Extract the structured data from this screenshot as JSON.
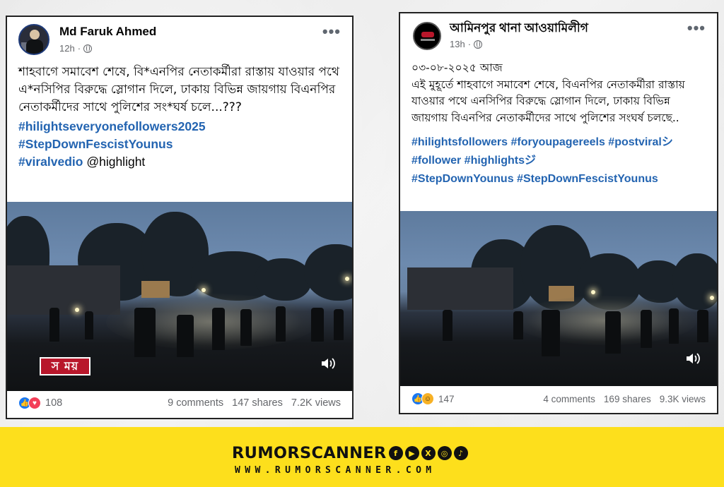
{
  "post1": {
    "author": "Md Faruk Ahmed",
    "time": "12h",
    "more": "•••",
    "text": "শাহবাগে সমাবেশ শেষে, বি*এনপির নেতাকর্মীরা রাস্তায় যাওয়ার পথে এ*নসিপির বিরুদ্ধে স্লোগান দিলে, ঢাকায় বিভিন্ন জায়গায় বিএনপির নেতাকর্মীদের সাথে পুলিশের সং*ঘর্ষ চলে...???",
    "hashtags": [
      "#hilightseveryonefollowers2025",
      "#StepDownFescistYounus",
      "#viralvedio"
    ],
    "mention": "@highlight",
    "video_logo": "স ময়",
    "reaction_count": "108",
    "comments": "9 comments",
    "shares": "147 shares",
    "views": "7.2K views"
  },
  "post2": {
    "author": "আমিনপুর থানা আওয়ামিলীগ",
    "time": "13h",
    "more": "•••",
    "date_line": "০৩-০৮-২০২৫ আজ",
    "text": "এই মুহূর্তে শাহবাগে সমাবেশ শেষে, বিএনপির নেতাকর্মীরা রাস্তায় যাওয়ার পথে এনসিপির বিরুদ্ধে স্লোগান দিলে, ঢাকায় বিভিন্ন জায়গায় বিএনপির নেতাকর্মীদের সাথে পুলিশের সংঘর্ষ চলছে..",
    "hashtag_lines": [
      "#hilightsfollowers #foryoupagereels #postviralシ",
      "#follower #highlightsジ",
      "#StepDownYounus #StepDownFescistYounus"
    ],
    "reaction_count": "147",
    "comments": "4 comments",
    "shares": "169 shares",
    "views": "9.3K views"
  },
  "banner": {
    "brand": "RUMORSCANNER",
    "url": "WWW.RUMORSCANNER.COM",
    "social_icons": [
      "facebook-icon",
      "youtube-icon",
      "x-icon",
      "instagram-icon",
      "tiktok-icon"
    ],
    "background": "#fddf1c"
  },
  "colors": {
    "hashtag": "#2364b1",
    "like": "#1877f2",
    "love": "#f33e58"
  }
}
